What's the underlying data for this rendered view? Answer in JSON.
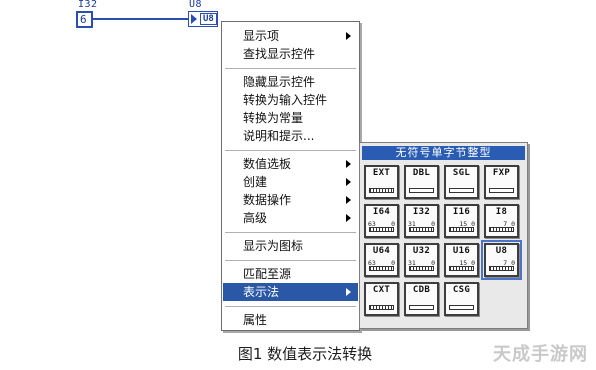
{
  "diagram": {
    "input_terminal": {
      "type_label": "I32",
      "value": "6"
    },
    "output_terminal": {
      "type_label": "U8",
      "tag": "U8"
    }
  },
  "menu": {
    "items": [
      {
        "label": "显示项",
        "submenu": true
      },
      {
        "label": "查找显示控件",
        "submenu": false
      },
      {
        "label": "隐藏显示控件",
        "submenu": false
      },
      {
        "label": "转换为输入控件",
        "submenu": false
      },
      {
        "label": "转换为常量",
        "submenu": false
      },
      {
        "label": "说明和提示...",
        "submenu": false
      },
      {
        "label": "数值选板",
        "submenu": true
      },
      {
        "label": "创建",
        "submenu": true
      },
      {
        "label": "数据操作",
        "submenu": true
      },
      {
        "label": "高级",
        "submenu": true
      },
      {
        "label": "显示为图标",
        "submenu": false
      },
      {
        "label": "匹配至源",
        "submenu": false
      },
      {
        "label": "表示法",
        "submenu": true,
        "highlighted": true
      },
      {
        "label": "属性",
        "submenu": false
      }
    ]
  },
  "palette": {
    "title": "无符号单字节整型",
    "tiles": [
      {
        "label": "EXT",
        "nums_left": "",
        "nums_right": "",
        "bar": "dotted"
      },
      {
        "label": "DBL",
        "nums_left": "",
        "nums_right": "",
        "bar": "plain"
      },
      {
        "label": "SGL",
        "nums_left": "",
        "nums_right": "",
        "bar": "plain"
      },
      {
        "label": "FXP",
        "nums_left": "",
        "nums_right": "",
        "bar": "plain"
      },
      {
        "label": "I64",
        "nums_left": "63",
        "nums_right": "0",
        "bar": "dotted"
      },
      {
        "label": "I32",
        "nums_left": "31",
        "nums_right": "0",
        "bar": "dotted"
      },
      {
        "label": "I16",
        "nums_left": "",
        "nums_right": "15 0",
        "bar": "dotted"
      },
      {
        "label": "I8",
        "nums_left": "",
        "nums_right": "7 0",
        "bar": "dotted"
      },
      {
        "label": "U64",
        "nums_left": "63",
        "nums_right": "0",
        "bar": "dotted"
      },
      {
        "label": "U32",
        "nums_left": "31",
        "nums_right": "0",
        "bar": "dotted"
      },
      {
        "label": "U16",
        "nums_left": "",
        "nums_right": "15 0",
        "bar": "dotted"
      },
      {
        "label": "U8",
        "nums_left": "",
        "nums_right": "7 0",
        "bar": "dotted",
        "selected": true
      },
      {
        "label": "CXT",
        "nums_left": "",
        "nums_right": "",
        "bar": "dotted"
      },
      {
        "label": "CDB",
        "nums_left": "",
        "nums_right": "",
        "bar": "plain"
      },
      {
        "label": "CSG",
        "nums_left": "",
        "nums_right": "",
        "bar": "plain"
      }
    ]
  },
  "caption": "图1 数值表示法转换",
  "watermark": "天成手游网"
}
